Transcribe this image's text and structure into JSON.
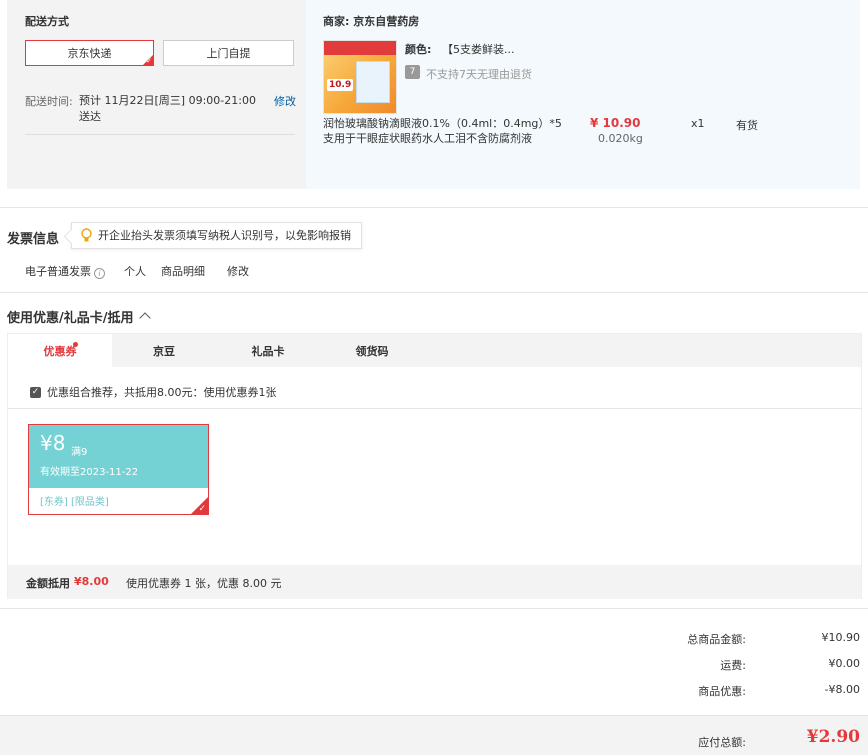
{
  "delivery": {
    "title": "配送方式",
    "options": [
      "京东快递",
      "上门自提"
    ],
    "time_label": "配送时间:",
    "time_value": "预计 11月22日[周三] 09:00-21:00 送达",
    "edit": "修改"
  },
  "order": {
    "merchant": "商家: 京东自营药房",
    "color_label": "颜色:",
    "color_value": "【5支娄鲜装...",
    "return_icon": "7",
    "return_policy": "不支持7天无理由退货",
    "thumb_badge": "10.9",
    "product_name": "润怡玻璃酸钠滴眼液0.1%（0.4ml：0.4mg）*5支用于干眼症状眼药水人工泪不含防腐剂液",
    "price": "¥ 10.90",
    "weight": "0.020kg",
    "quantity": "x1",
    "stock": "有货"
  },
  "invoice": {
    "title": "发票信息",
    "tip": "开企业抬头发票须填写纳税人识别号，以免影响报销",
    "type": "电子普通发票",
    "holder": "个人",
    "content": "商品明细",
    "edit": "修改"
  },
  "coupons": {
    "title": "使用优惠/礼品卡/抵用",
    "tabs": [
      "优惠券",
      "京豆",
      "礼品卡",
      "领货码"
    ],
    "combo_text": "优惠组合推荐，共抵用8.00元：使用优惠券1张",
    "card": {
      "amount": "¥8",
      "condition": "满9",
      "valid": "有效期至2023-11-22",
      "tags": "[东券]  [限品类]"
    },
    "summary_label": "金额抵用",
    "summary_amount": "¥8.00",
    "summary_detail": "使用优惠券 1 张，优惠 8.00 元"
  },
  "totals": {
    "rows": [
      {
        "label": "总商品金额:",
        "value": "¥10.90"
      },
      {
        "label": "运费:",
        "value": "¥0.00"
      },
      {
        "label": "商品优惠:",
        "value": "-¥8.00"
      }
    ],
    "pay_label": "应付总额:",
    "pay_value": "¥2.90"
  },
  "colors": {
    "accent": "#e4393c",
    "link": "#005ea7",
    "coupon": "#74d2d5"
  }
}
